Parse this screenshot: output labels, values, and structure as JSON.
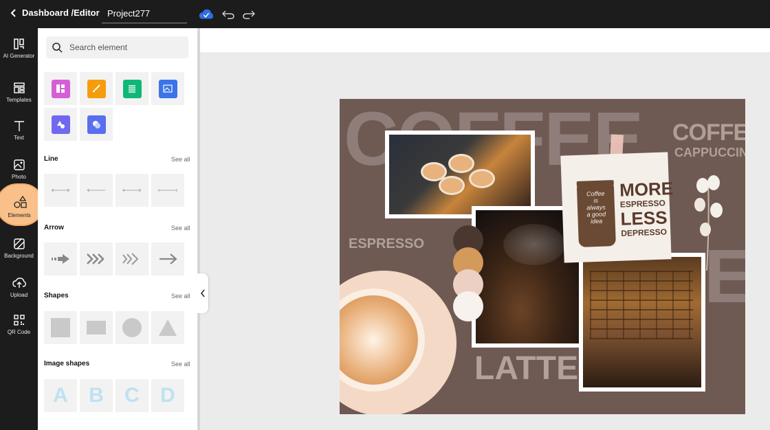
{
  "topbar": {
    "back_label": "Dashboard /Editor",
    "project_name": "Project277"
  },
  "rail": {
    "items": [
      {
        "label": "AI Generator",
        "icon": "ai-generator-icon"
      },
      {
        "label": "Templates",
        "icon": "templates-icon"
      },
      {
        "label": "Text",
        "icon": "text-icon"
      },
      {
        "label": "Photo",
        "icon": "photo-icon"
      },
      {
        "label": "Elements",
        "icon": "elements-icon"
      },
      {
        "label": "Background",
        "icon": "background-icon"
      },
      {
        "label": "Upload",
        "icon": "upload-icon"
      },
      {
        "label": "QR Code",
        "icon": "qr-code-icon"
      }
    ],
    "active": "Elements"
  },
  "panel": {
    "search_placeholder": "Search element",
    "see_all": "See all",
    "sections": {
      "line": "Line",
      "arrow": "Arrow",
      "shapes": "Shapes",
      "image_shapes": "Image shapes"
    },
    "image_shape_letters": [
      "A",
      "B",
      "C",
      "D"
    ]
  },
  "design": {
    "big_word": "COFFEE",
    "corner_title": "COFFEE",
    "corner_sub": "CAPPUCCINO",
    "espresso": "ESPRESSO",
    "latte": "LATTE",
    "note_lines": [
      "MORE",
      "ESPRESSO",
      "LESS",
      "DEPRESSO"
    ],
    "cup_script": [
      "Coffee",
      "is",
      "always",
      "a good",
      "idea"
    ],
    "right_word": "E"
  },
  "colors": {
    "accent": "#f9c08a",
    "canvas_bg": "#6f5953",
    "swatches": [
      "#4a3830",
      "#d49a5c",
      "#ecd0c4",
      "#f7f2ee"
    ]
  }
}
